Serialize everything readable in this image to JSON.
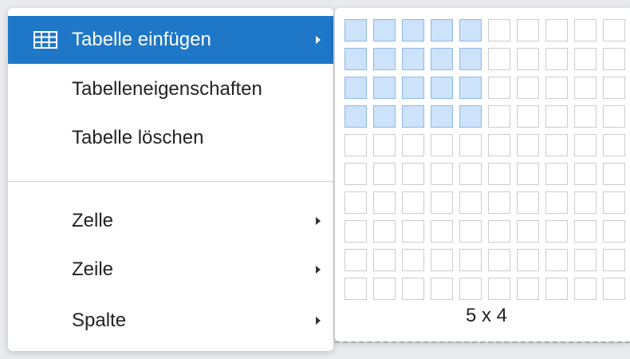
{
  "menu": {
    "items": [
      {
        "label": "Tabelle einfügen",
        "icon": "table-icon",
        "submenu": true,
        "active": true
      },
      {
        "label": "Tabelleneigenschaften",
        "submenu": false
      },
      {
        "label": "Tabelle löschen",
        "submenu": false
      },
      {
        "label": "Zelle",
        "submenu": true
      },
      {
        "label": "Zeile",
        "submenu": true
      },
      {
        "label": "Spalte",
        "submenu": true
      }
    ]
  },
  "table_picker": {
    "selected_cols": 5,
    "selected_rows": 4,
    "label": "5 x 4"
  },
  "colors": {
    "accent": "#1f77c8",
    "selected_cell": "#cde2fb"
  }
}
